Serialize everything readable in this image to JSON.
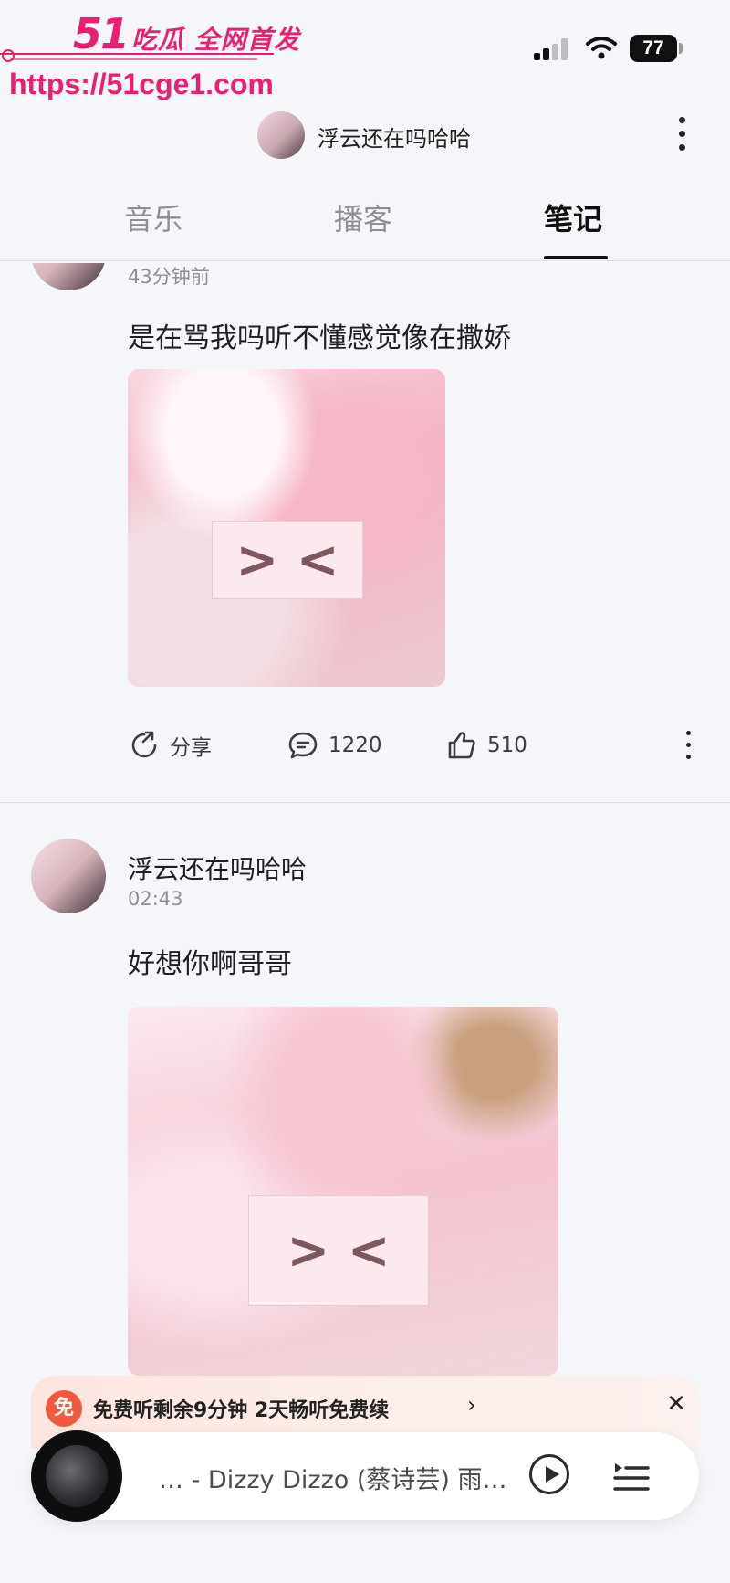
{
  "watermark": {
    "brand": "51",
    "brand_cn": "吃瓜 全网首发",
    "url": "https://51cge1.com"
  },
  "status_bar": {
    "battery": "77"
  },
  "header": {
    "title": "浮云还在吗哈哈"
  },
  "tabs": [
    {
      "label": "音乐",
      "active": false
    },
    {
      "label": "播客",
      "active": false
    },
    {
      "label": "笔记",
      "active": true
    }
  ],
  "posts": [
    {
      "author": "",
      "time": "43分钟前",
      "text": "是在骂我吗听不懂感觉像在撒娇",
      "censor_label": "> <",
      "actions": {
        "share_label": "分享",
        "comments": "1220",
        "likes": "510"
      }
    },
    {
      "author": "浮云还在吗哈哈",
      "time": "02:43",
      "text": "好想你啊哥哥",
      "censor_label": "> <"
    }
  ],
  "promo": {
    "badge": "免",
    "text": "免费听剩余9分钟 2天畅听免费续"
  },
  "player": {
    "track": "… - Dizzy Dizzo (蔡诗芸)    雨…"
  },
  "icons": [
    "signal-icon",
    "wifi-icon",
    "battery-icon",
    "more-icon",
    "share-icon",
    "comment-icon",
    "like-icon",
    "close-icon",
    "play-icon",
    "playlist-icon",
    "chevron-right-icon"
  ],
  "colors": {
    "watermark": "#ea1f74",
    "promo_badge": "#f0593f",
    "accent_text": "#111111"
  }
}
